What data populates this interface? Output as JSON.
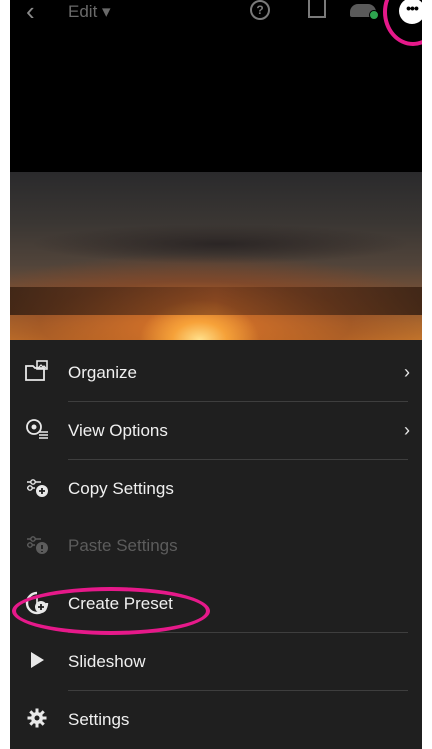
{
  "topbar": {
    "back_glyph": "‹",
    "edit_label": "Edit ▾",
    "help_glyph": "?",
    "more_glyph": "•••"
  },
  "menu": {
    "items": [
      {
        "label": "Organize",
        "icon": "folder-image-icon",
        "has_chevron": true,
        "enabled": true
      },
      {
        "label": "View Options",
        "icon": "view-options-icon",
        "has_chevron": true,
        "enabled": true
      },
      {
        "label": "Copy Settings",
        "icon": "copy-settings-icon",
        "has_chevron": false,
        "enabled": true
      },
      {
        "label": "Paste Settings",
        "icon": "paste-settings-icon",
        "has_chevron": false,
        "enabled": false
      },
      {
        "label": "Create Preset",
        "icon": "create-preset-icon",
        "has_chevron": false,
        "enabled": true
      },
      {
        "label": "Slideshow",
        "icon": "play-icon",
        "has_chevron": false,
        "enabled": true
      },
      {
        "label": "Settings",
        "icon": "gear-icon",
        "has_chevron": false,
        "enabled": true
      }
    ],
    "chevron": "›"
  },
  "highlight_color": "#e6198a"
}
